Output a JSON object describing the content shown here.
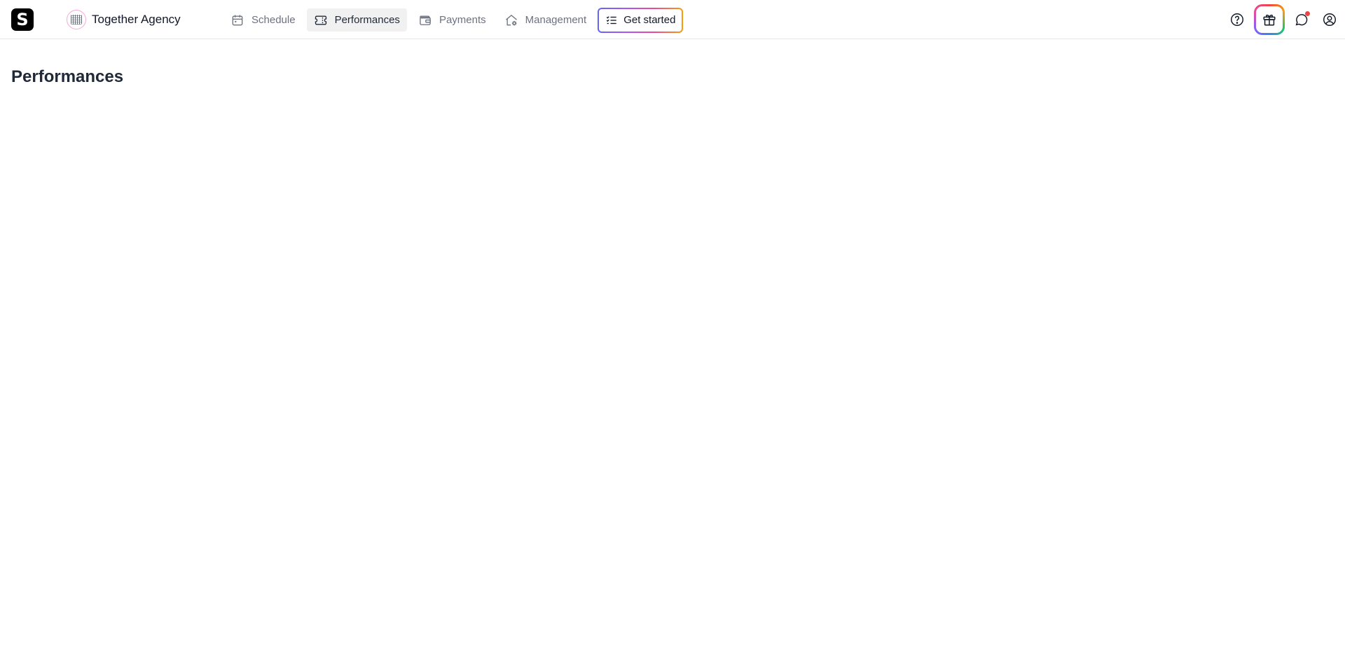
{
  "brand": {
    "logo_letter": "S"
  },
  "agency": {
    "name": "Together Agency"
  },
  "nav": {
    "items": [
      {
        "label": "Schedule",
        "icon": "calendar-icon"
      },
      {
        "label": "Performances",
        "icon": "ticket-icon",
        "active": true
      },
      {
        "label": "Payments",
        "icon": "wallet-icon"
      },
      {
        "label": "Management",
        "icon": "home-gear-icon"
      }
    ],
    "get_started": {
      "label": "Get started",
      "icon": "checklist-icon"
    }
  },
  "tools": [
    "help-icon",
    "gift-icon",
    "chat-icon",
    "user-circle-icon"
  ],
  "main": {
    "title": "Performances"
  },
  "colors": {
    "active_bg": "#f1f1f2",
    "muted_text": "#6b7280",
    "notification": "#ef4444"
  }
}
